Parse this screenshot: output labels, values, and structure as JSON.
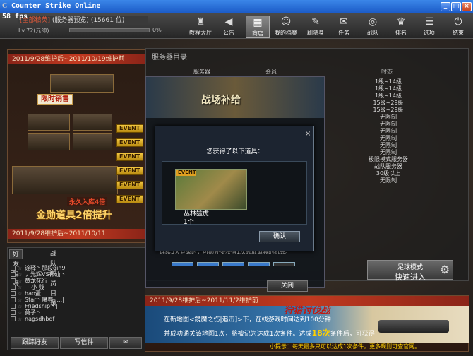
{
  "window": {
    "title": "Counter Strike Online",
    "fps": "58 fps",
    "min_label": "_",
    "max_label": "□",
    "close_label": "×"
  },
  "user": {
    "name": "[全部精英]",
    "room": "(服务器预览)",
    "exp": "(15661 位)",
    "level": "Lv.72(元帥)",
    "pct": "0%"
  },
  "toolbar": [
    {
      "label": "教程大厅",
      "icon": "trophy-icon"
    },
    {
      "label": "公告",
      "icon": "megaphone-icon"
    },
    {
      "label": "商店",
      "icon": "shop-icon"
    },
    {
      "label": "我的档案",
      "icon": "profile-icon"
    },
    {
      "label": "刷随身",
      "icon": "pencil-icon"
    },
    {
      "label": "任务",
      "icon": "mission-icon"
    },
    {
      "label": "战队",
      "icon": "clan-icon"
    },
    {
      "label": "排名",
      "icon": "rank-icon"
    },
    {
      "label": "选项",
      "icon": "options-icon"
    },
    {
      "label": "结束",
      "icon": "power-icon"
    }
  ],
  "promo": {
    "header": "2011/9/28维护后~2011/10/19维护前",
    "limited": "限时销售",
    "permanent": "永久入库4倍",
    "gold": "金勋道具2倍提升",
    "footer": "2011/9/28维护后~2011/10/11"
  },
  "events": [
    "EVENT",
    "EVENT",
    "EVENT",
    "EVENT",
    "EVENT",
    "EVENT"
  ],
  "friends": {
    "tabs": [
      "好友目录",
      "战队成员目录"
    ],
    "rows": [
      "诠释丶那段qin9",
      "丿光辉VS神仙丶",
      "黄龙花行",
      "~ 小 贱",
      "hao蛋",
      "Star丶魔尊.....|",
      "Friedship丶|",
      "莫子丶",
      "nagsdhbdf"
    ],
    "btn_add": "跟踪好友",
    "btn_mail": "写信件",
    "mail_icon": "envelope-icon"
  },
  "server": {
    "title": "服务器目录",
    "col1": "服务器",
    "col2": "会员",
    "col3": "时态",
    "list": [
      "1级~14级",
      "1级~14级",
      "1级~14级",
      "15级~29级",
      "15级~29级",
      "无限制",
      "无限制",
      "无限制",
      "无限制",
      "无限制",
      "无限制",
      "极限模式服务器",
      "战队服务器",
      "30级以上",
      "无限制"
    ],
    "quick_mode": "足球模式",
    "quick_enter": "快速进入"
  },
  "supply": {
    "title": "战场补给",
    "tip": "连续5天登录时，可额外多获得1次领取道具的机会。",
    "progress": [
      true,
      true,
      true,
      true,
      false
    ],
    "close": "关闭"
  },
  "dialog": {
    "title": "您获得了以下道具：",
    "item_tag": "EVENT",
    "item_name": "丛林猛虎",
    "item_qty": "1个",
    "ok": "确认",
    "close": "×"
  },
  "bottom": {
    "header": "2011/9/28维护后~2011/11/2维护前",
    "title": "狩猎讨伐战",
    "line1": "在新地图<鏡魔之伤|追击]>下，在线游戏时间达到100分钟",
    "line2a": "并成功通关该地图1次，将被记为达成1次条件。达成",
    "line2b": "18次",
    "line2c": "条件后，可获得",
    "hint": "小提示：每天最多只可以达成1次条件，更多规则可查官网。"
  }
}
